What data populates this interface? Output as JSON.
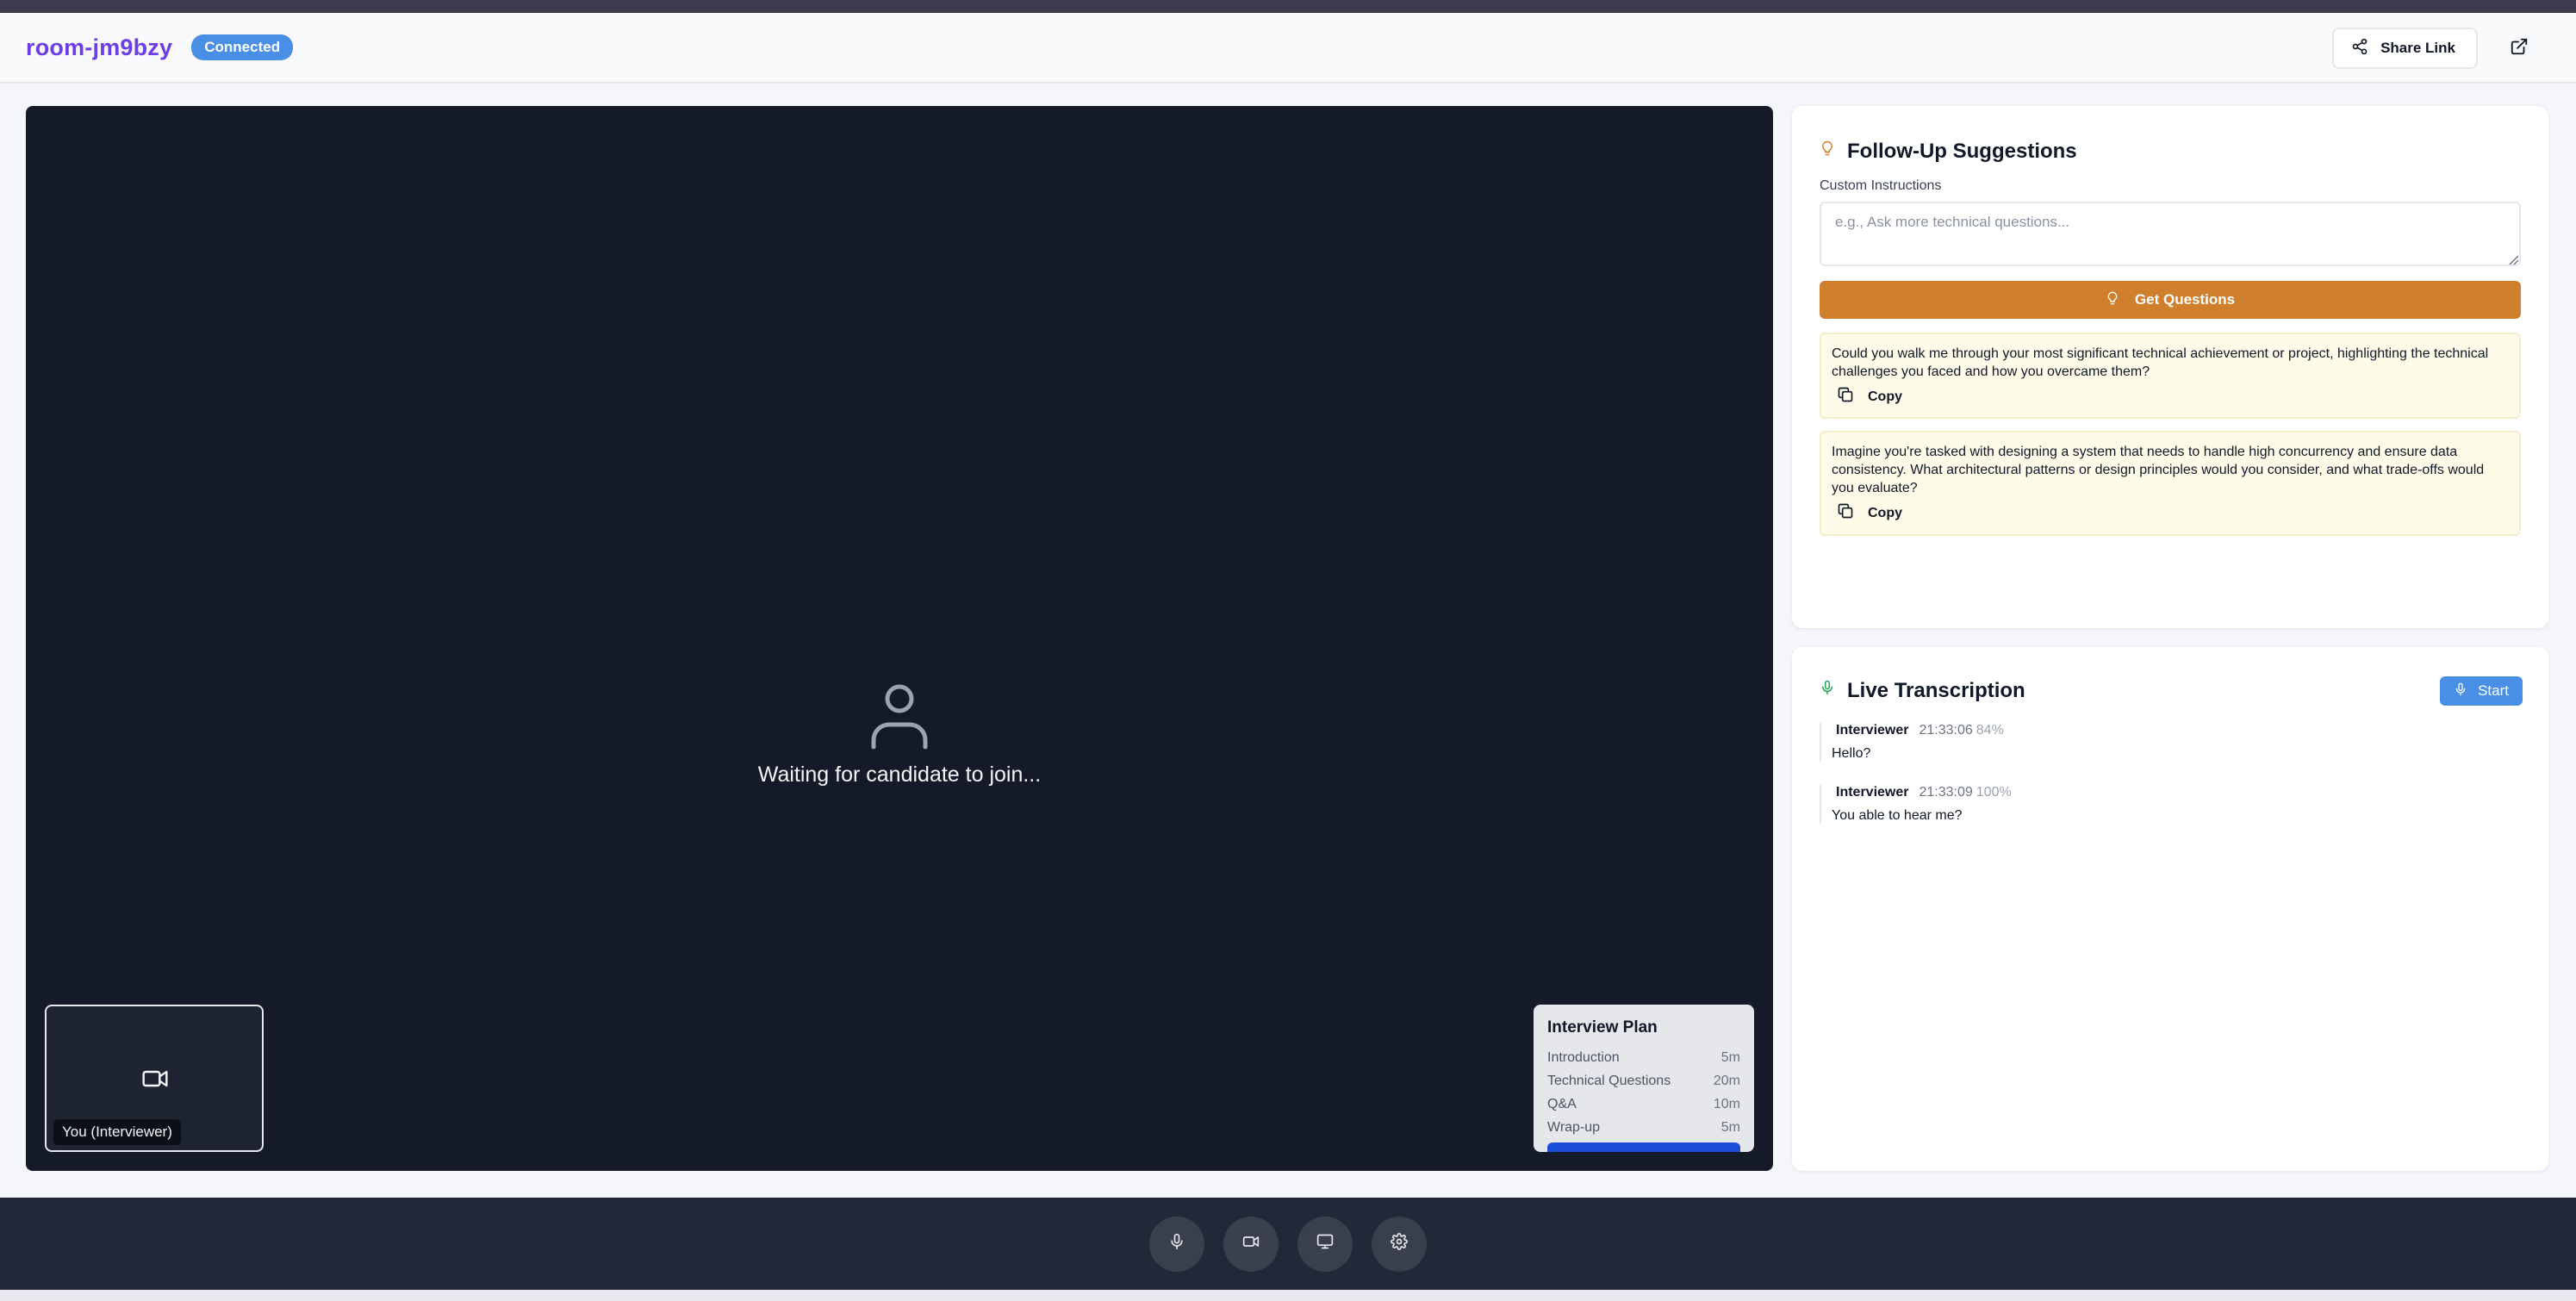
{
  "header": {
    "room_name": "room-jm9bzy",
    "status_badge": "Connected",
    "share_label": "Share Link"
  },
  "stage": {
    "waiting_text": "Waiting for candidate to join...",
    "self_label": "You (Interviewer)"
  },
  "plan": {
    "title": "Interview Plan",
    "items": [
      {
        "name": "Introduction",
        "duration": "5m"
      },
      {
        "name": "Technical Questions",
        "duration": "20m"
      },
      {
        "name": "Q&A",
        "duration": "10m"
      },
      {
        "name": "Wrap-up",
        "duration": "5m"
      }
    ]
  },
  "suggestions": {
    "title": "Follow-Up Suggestions",
    "custom_label": "Custom Instructions",
    "custom_placeholder": "e.g., Ask more technical questions...",
    "get_button": "Get Questions",
    "copy_label": "Copy",
    "questions": [
      "Could you walk me through your most significant technical achievement or project, highlighting the technical challenges you faced and how you overcame them?",
      "Imagine you're tasked with designing a system that needs to handle high concurrency and ensure data consistency. What architectural patterns or design principles would you consider, and what trade-offs would you evaluate?"
    ]
  },
  "transcription": {
    "title": "Live Transcription",
    "start_label": "Start",
    "entries": [
      {
        "speaker": "Interviewer",
        "time": "21:33:06",
        "confidence": "84%",
        "text": "Hello?"
      },
      {
        "speaker": "Interviewer",
        "time": "21:33:09",
        "confidence": "100%",
        "text": "You able to hear me?"
      }
    ]
  },
  "controls": {
    "icons": [
      "microphone-icon",
      "video-camera-icon",
      "screen-share-icon",
      "settings-gear-icon"
    ]
  },
  "colors": {
    "brand": "#6d3ee6",
    "badge": "#4a8fe6",
    "get_button": "#d07f2c",
    "suggestion_bg": "#fefbe9",
    "stage_bg": "#141a28",
    "bar_bg": "#232838"
  }
}
